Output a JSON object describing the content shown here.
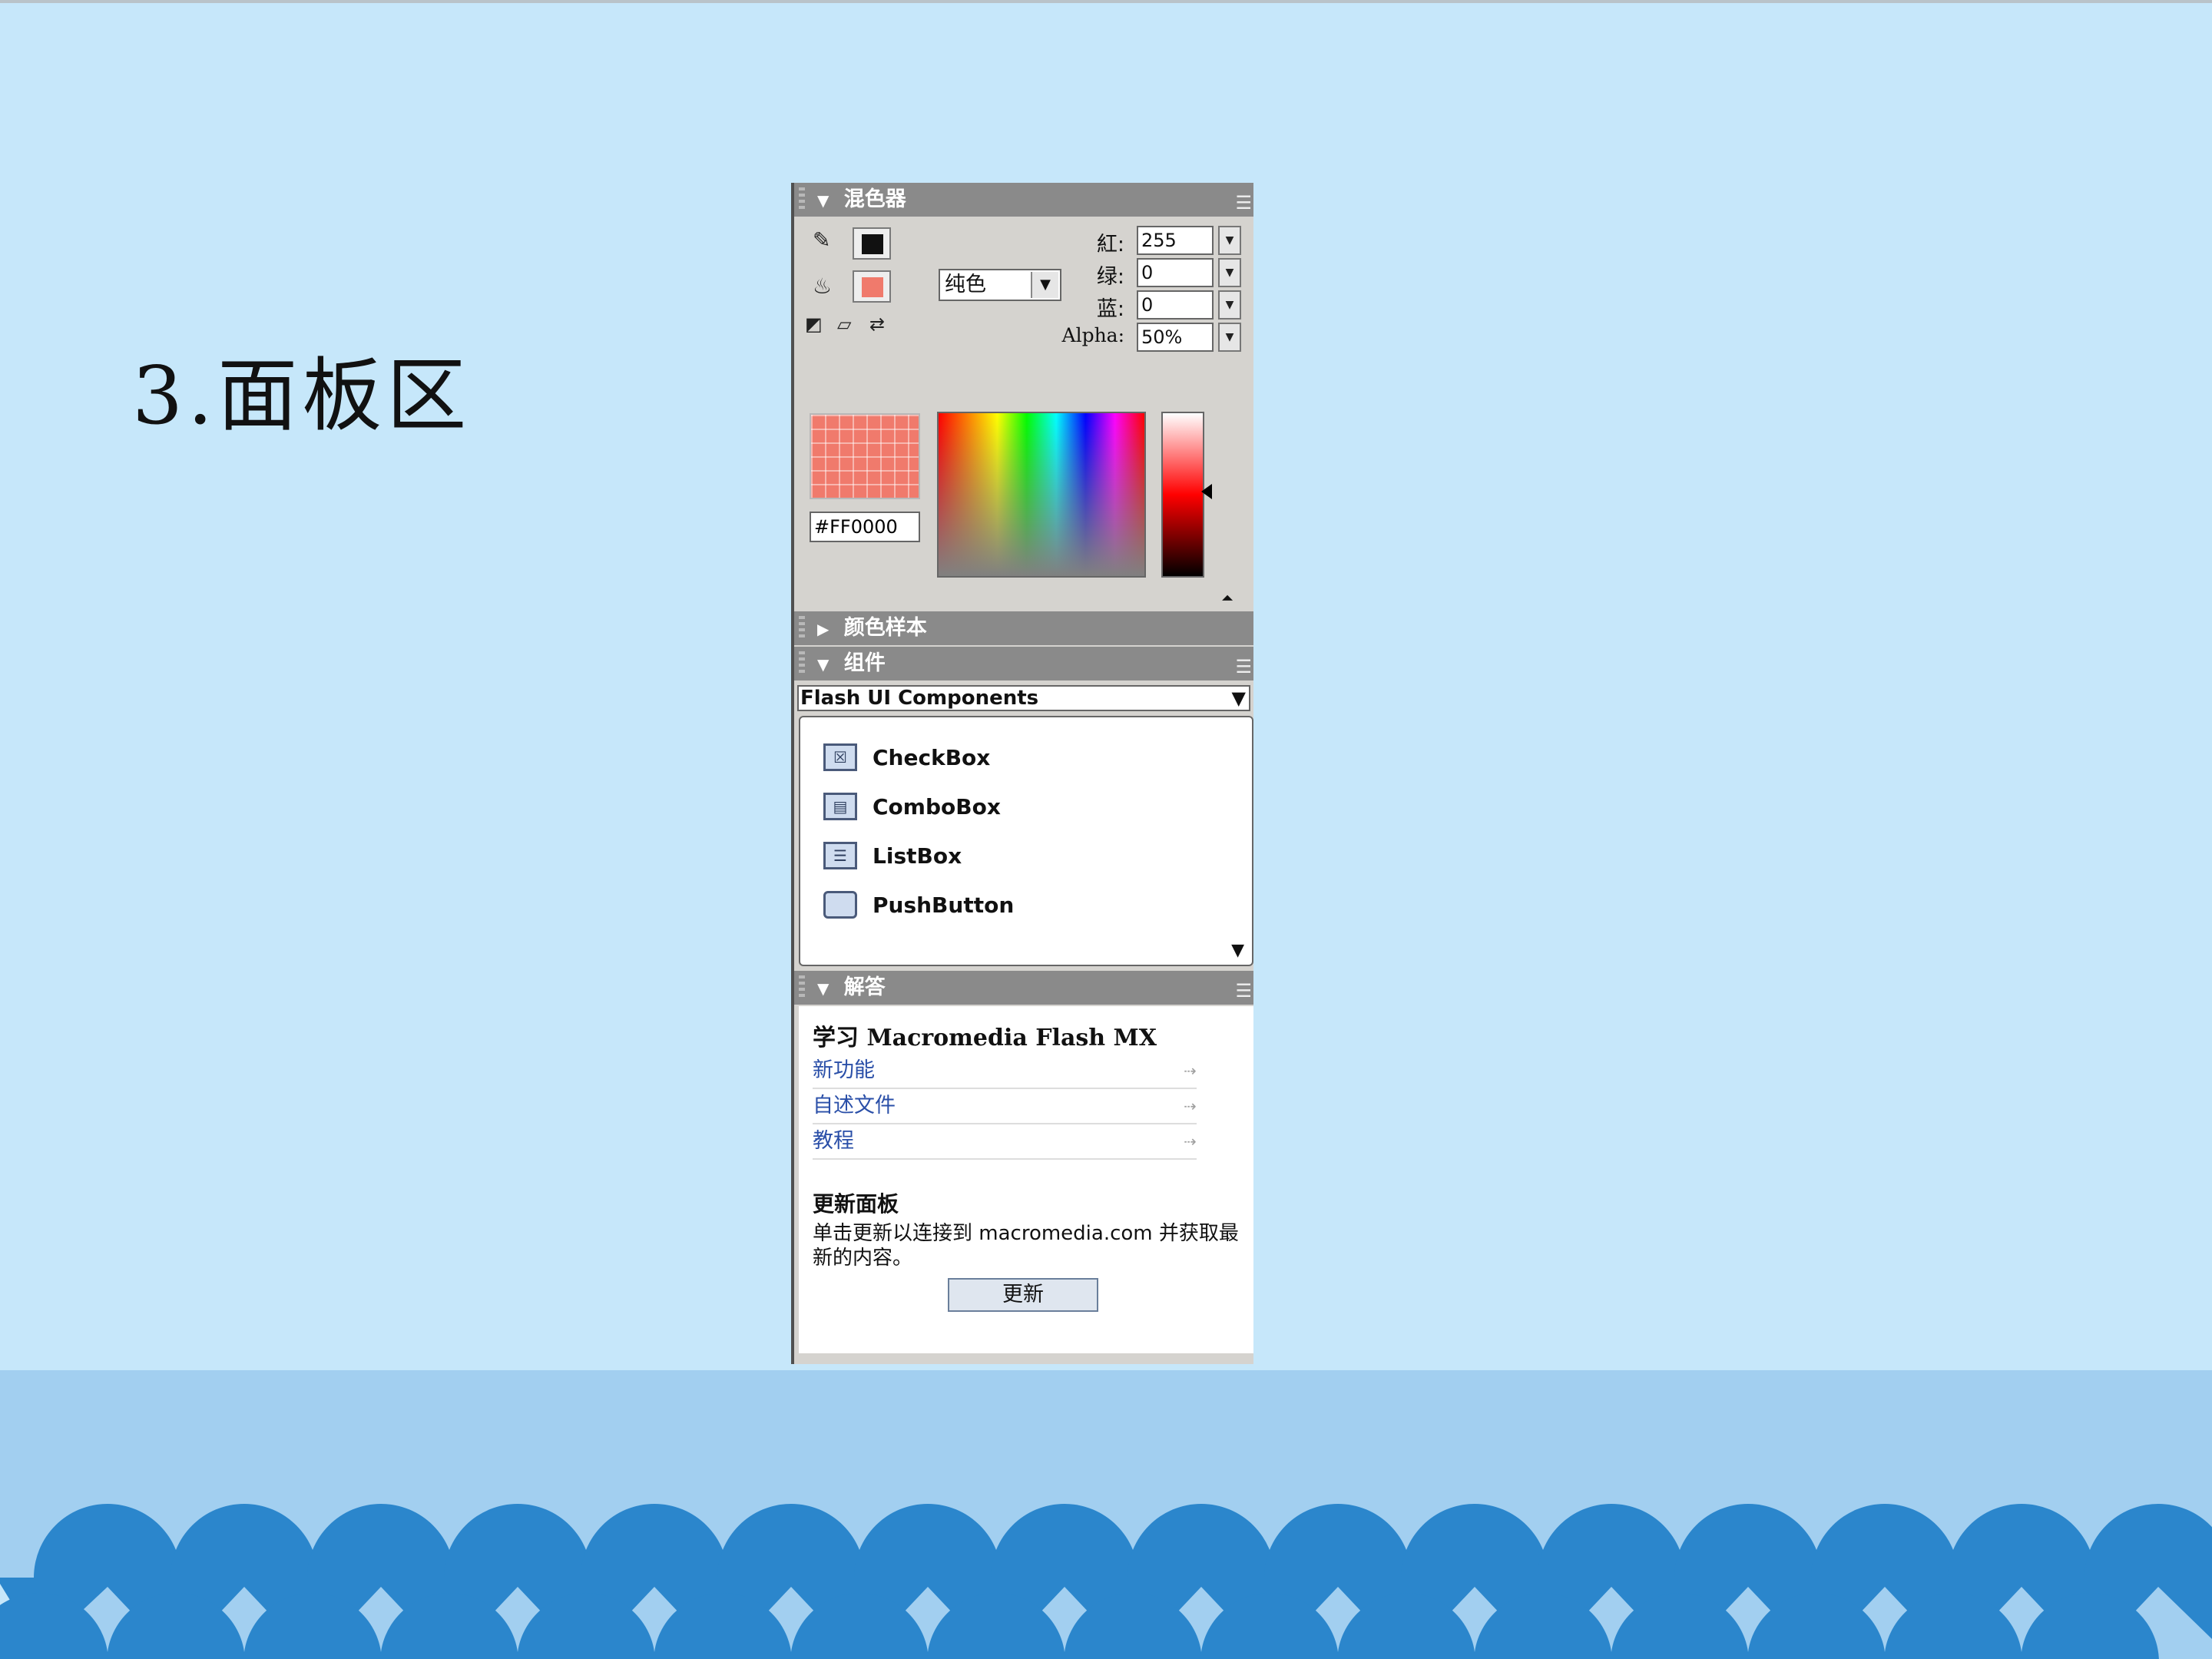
{
  "slide": {
    "title": "3.面板区"
  },
  "mixer": {
    "title": "混色器",
    "fill_type": "纯色",
    "fields": [
      {
        "label": "紅:",
        "value": "255"
      },
      {
        "label": "绿:",
        "value": "0"
      },
      {
        "label": "蓝:",
        "value": "0"
      },
      {
        "label": "Alpha:",
        "value": "50%"
      }
    ],
    "hex": "#FF0000",
    "colors": {
      "selected": "#ff0000",
      "preview": "#f07a6c"
    }
  },
  "swatches": {
    "title": "颜色样本"
  },
  "components": {
    "title": "组件",
    "set": "Flash UI Components",
    "items": [
      {
        "label": "CheckBox",
        "icon": "checkbox-icon"
      },
      {
        "label": "ComboBox",
        "icon": "combobox-icon"
      },
      {
        "label": "ListBox",
        "icon": "listbox-icon"
      },
      {
        "label": "PushButton",
        "icon": "pushbutton-icon"
      }
    ]
  },
  "answers": {
    "title": "解答",
    "heading": "学习 Macromedia Flash MX",
    "links": [
      "新功能",
      "自述文件",
      "教程"
    ],
    "update_heading": "更新面板",
    "update_text": "单击更新以连接到 macromedia.com 并获取最新的内容。",
    "update_button": "更新"
  }
}
